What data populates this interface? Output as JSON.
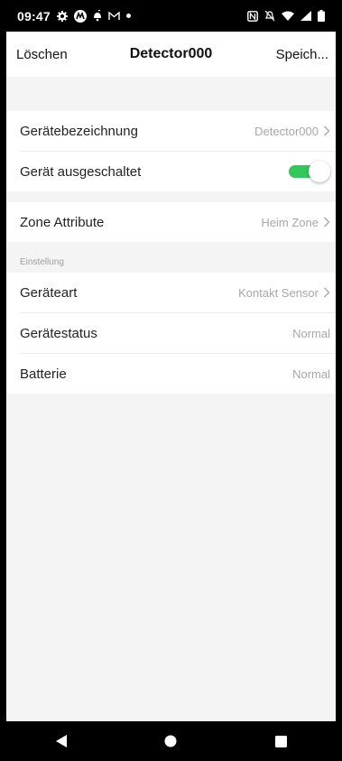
{
  "status_bar": {
    "time": "09:47",
    "left_icons": [
      "gear-icon",
      "motorola-icon",
      "notification-icon",
      "gmail-icon",
      "dot-icon"
    ],
    "right_icons": [
      "nfc-icon",
      "mute-icon",
      "wifi-icon",
      "signal-icon",
      "battery-icon"
    ]
  },
  "header": {
    "left_label": "Löschen",
    "title": "Detector000",
    "right_label": "Speich..."
  },
  "device": {
    "name_label": "Gerätebezeichnung",
    "name_value": "Detector000",
    "off_label": "Gerät ausgeschaltet",
    "off_toggle": true
  },
  "zone": {
    "label": "Zone Attribute",
    "value": "Heim Zone"
  },
  "settings": {
    "section_label": "Einstellung",
    "type_label": "Geräteart",
    "type_value": "Kontakt Sensor",
    "status_label": "Gerätestatus",
    "status_value": "Normal",
    "battery_label": "Batterie",
    "battery_value": "Normal"
  },
  "colors": {
    "toggle_on": "#34c759",
    "background": "#f4f4f4",
    "muted_text": "#a7a7a7"
  },
  "nav_bar": [
    "back-icon",
    "home-icon",
    "recents-icon"
  ]
}
